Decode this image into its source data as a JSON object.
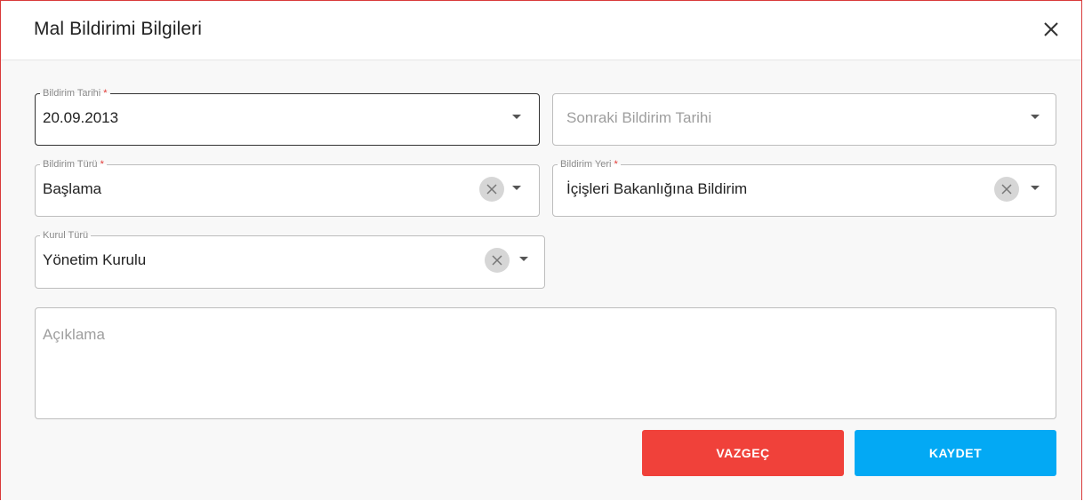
{
  "dialog": {
    "title": "Mal Bildirimi Bilgileri",
    "close_icon": "close-icon"
  },
  "form": {
    "bildirim_tarihi": {
      "label": "Bildirim Tarihi",
      "required_mark": "*",
      "value": "20.09.2013"
    },
    "sonraki_bildirim_tarihi": {
      "placeholder": "Sonraki Bildirim Tarihi"
    },
    "bildirim_turu": {
      "label": "Bildirim Türü",
      "required_mark": "*",
      "value": "Başlama"
    },
    "bildirim_yeri": {
      "label": "Bildirim Yeri",
      "required_mark": "*",
      "value": "İçişleri Bakanlığına Bildirim"
    },
    "kurul_turu": {
      "label": "Kurul Türü",
      "value": "Yönetim Kurulu"
    },
    "aciklama": {
      "placeholder": "Açıklama"
    }
  },
  "buttons": {
    "cancel_label": "VAZGEÇ",
    "save_label": "KAYDET"
  },
  "colors": {
    "cancel": "#f0413a",
    "save": "#03a9f4",
    "required": "#e53935",
    "dialog_border": "#d93a3a"
  }
}
